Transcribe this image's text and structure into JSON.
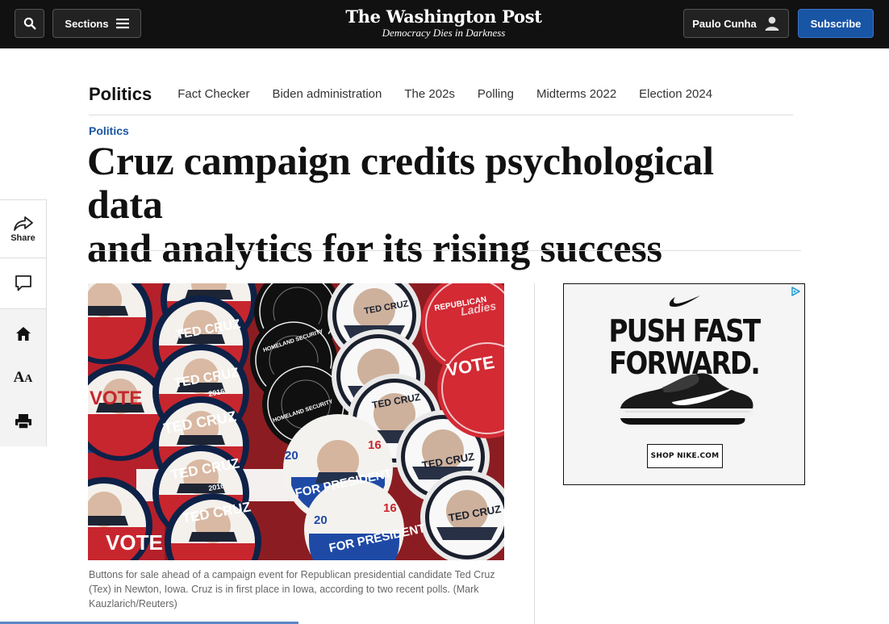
{
  "header": {
    "sections_label": "Sections",
    "masthead": "The Washington Post",
    "tagline": "Democracy Dies in Darkness",
    "user_name": "Paulo Cunha",
    "subscribe_label": "Subscribe"
  },
  "section_nav": {
    "title": "Politics",
    "links": [
      "Fact Checker",
      "Biden administration",
      "The 202s",
      "Polling",
      "Midterms 2022",
      "Election 2024"
    ]
  },
  "article": {
    "kicker": "Politics",
    "headline_line1": "Cruz campaign credits psychological data",
    "headline_line2": "and analytics for its rising success",
    "photo_caption": "Buttons for sale ahead of a campaign event for Republican presidential candidate Ted Cruz (Tex) in Newton, Iowa. Cruz is in first place in Iowa, according to two recent polls. (Mark Kauzlarich/Reuters)"
  },
  "photo_texts": {
    "ted_cruz": "TED CRUZ",
    "for_president": "FOR PRESIDENT",
    "year": "2016",
    "vote": "VOTE",
    "ladies": "Ladies",
    "republican": "REPUBLICAN",
    "homeland": "HOMELAND SECURITY",
    "number_20": "20",
    "number_16": "16"
  },
  "rail": {
    "share_label": "Share"
  },
  "ad": {
    "headline_line1": "PUSH FAST",
    "headline_line2": "FORWARD.",
    "cta": "SHOP NIKE.COM"
  },
  "colors": {
    "top_bar": "#111111",
    "accent_blue": "#1955a5",
    "caption_gray": "#666666"
  }
}
